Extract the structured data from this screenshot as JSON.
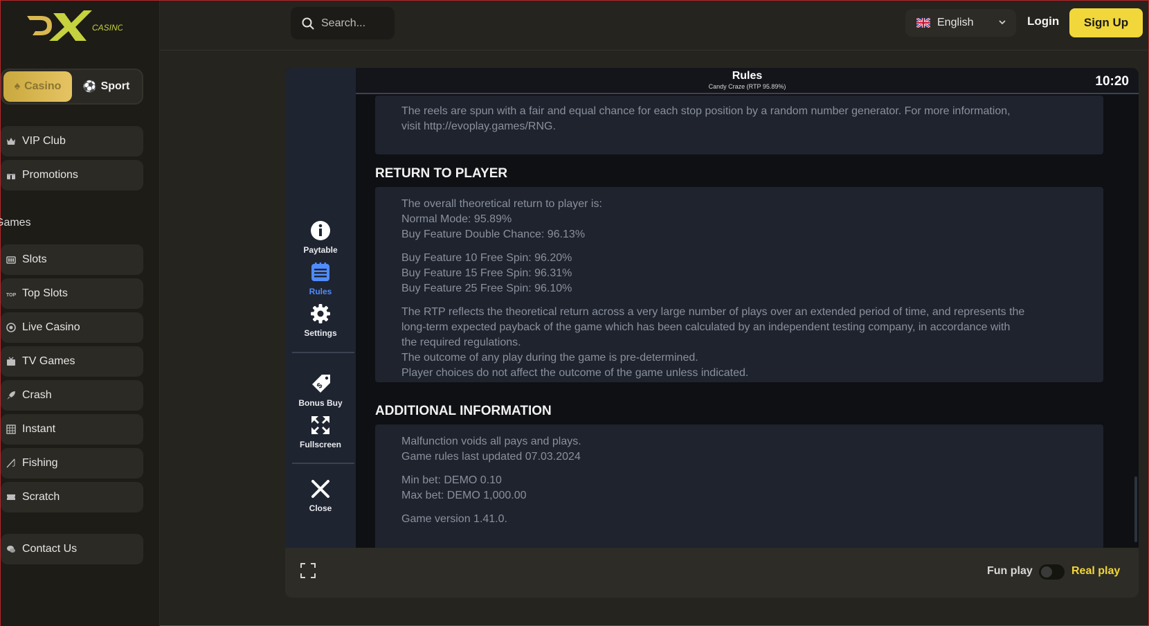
{
  "logo": {
    "brand": "DX",
    "sub": "CASINO"
  },
  "sidebar": {
    "switch": [
      {
        "label": "Casino",
        "icon": "spade-icon",
        "active": true
      },
      {
        "label": "Sport",
        "icon": "soccer-ball-icon",
        "active": false
      }
    ],
    "top_items": [
      {
        "label": "VIP Club",
        "icon": "crown-icon"
      },
      {
        "label": "Promotions",
        "icon": "gift-icon"
      }
    ],
    "section_label": "Games",
    "game_items": [
      {
        "label": "Slots",
        "icon": "slot-machine-icon"
      },
      {
        "label": "Top Slots",
        "icon": "top-badge-icon"
      },
      {
        "label": "Live Casino",
        "icon": "chip-icon"
      },
      {
        "label": "TV Games",
        "icon": "tv-icon"
      },
      {
        "label": "Crash",
        "icon": "rocket-icon"
      },
      {
        "label": "Instant",
        "icon": "grid-icon"
      },
      {
        "label": "Fishing",
        "icon": "fishing-rod-icon"
      },
      {
        "label": "Scratch",
        "icon": "ticket-icon"
      }
    ],
    "contact": {
      "label": "Contact Us",
      "icon": "chat-icon"
    }
  },
  "header": {
    "search_placeholder": "Search...",
    "language": "English",
    "login": "Login",
    "signup": "Sign Up"
  },
  "game": {
    "side": {
      "paytable": "Paytable",
      "rules": "Rules",
      "settings": "Settings",
      "bonus_buy": "Bonus Buy",
      "fullscreen": "Fullscreen",
      "close": "Close"
    },
    "title": "Rules",
    "subtitle": "Candy Craze (RTP 95.89%)",
    "clock": "10:20",
    "rng_text_1": "The reels are spun with a fair and equal chance for each stop position by a random number generator. For more information,",
    "rng_text_2": "visit http://evoplay.games/RNG.",
    "rtp": {
      "heading": "RETURN TO PLAYER",
      "lines_a": [
        "The overall theoretical return to player is:",
        "Normal Mode: 95.89%",
        "Buy Feature Double Chance: 96.13%"
      ],
      "lines_b": [
        "Buy Feature 10 Free Spin: 96.20%",
        "Buy Feature 15 Free Spin: 96.31%",
        "Buy Feature 25 Free Spin: 96.10%"
      ],
      "lines_c": [
        "The RTP reflects the theoretical return across a very large number of plays over an extended period of time, and represents the",
        "long-term expected payback of the game which has been calculated by an independent testing company, in accordance with",
        "the required regulations.",
        "The outcome of any play during the game is pre-determined.",
        "Player choices do not affect the outcome of the game unless indicated."
      ]
    },
    "additional": {
      "heading": "ADDITIONAL INFORMATION",
      "lines_a": [
        "Malfunction voids all pays and plays.",
        "Game rules last updated 07.03.2024"
      ],
      "lines_b": [
        "Min bet: DEMO 0.10",
        "Max bet: DEMO 1,000.00"
      ],
      "lines_c": [
        "Game version 1.41.0."
      ]
    }
  },
  "bottom": {
    "fun_play": "Fun play",
    "real_play": "Real play",
    "real_play_on": false
  },
  "colors": {
    "accent_yellow": "#f2d73a",
    "casino_gold": "#d9b850",
    "active_blue": "#4f8cff",
    "bg": "#25241e"
  }
}
